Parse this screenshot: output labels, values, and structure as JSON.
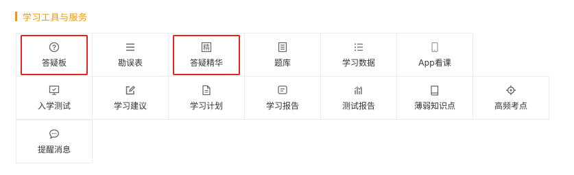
{
  "section": {
    "title": "学习工具与服务"
  },
  "colors": {
    "accent": "#f39800",
    "highlight_box": "#e2231a",
    "icon": "#666666"
  },
  "tools": [
    [
      {
        "label": "答疑板",
        "icon": "question-circle-icon",
        "highlighted": true
      },
      {
        "label": "勘误表",
        "icon": "list-lines-icon",
        "highlighted": false
      },
      {
        "label": "答疑精华",
        "icon": "jing-badge-icon",
        "highlighted": true
      },
      {
        "label": "题库",
        "icon": "document-lines-icon",
        "highlighted": false
      },
      {
        "label": "学习数据",
        "icon": "bullet-list-icon",
        "highlighted": false
      },
      {
        "label": "App看课",
        "icon": "phone-icon",
        "highlighted": false
      }
    ],
    [
      {
        "label": "入学测试",
        "icon": "monitor-check-icon",
        "highlighted": false
      },
      {
        "label": "学习建议",
        "icon": "edit-icon",
        "highlighted": false
      },
      {
        "label": "学习计划",
        "icon": "file-icon",
        "highlighted": false
      },
      {
        "label": "学习报告",
        "icon": "report-icon",
        "highlighted": false
      },
      {
        "label": "测试报告",
        "icon": "bar-chart-icon",
        "highlighted": false
      },
      {
        "label": "薄弱知识点",
        "icon": "book-icon",
        "highlighted": false
      },
      {
        "label": "高频考点",
        "icon": "target-icon",
        "highlighted": false
      }
    ],
    [
      {
        "label": "提醒消息",
        "icon": "chat-bubble-icon",
        "highlighted": false
      }
    ]
  ]
}
